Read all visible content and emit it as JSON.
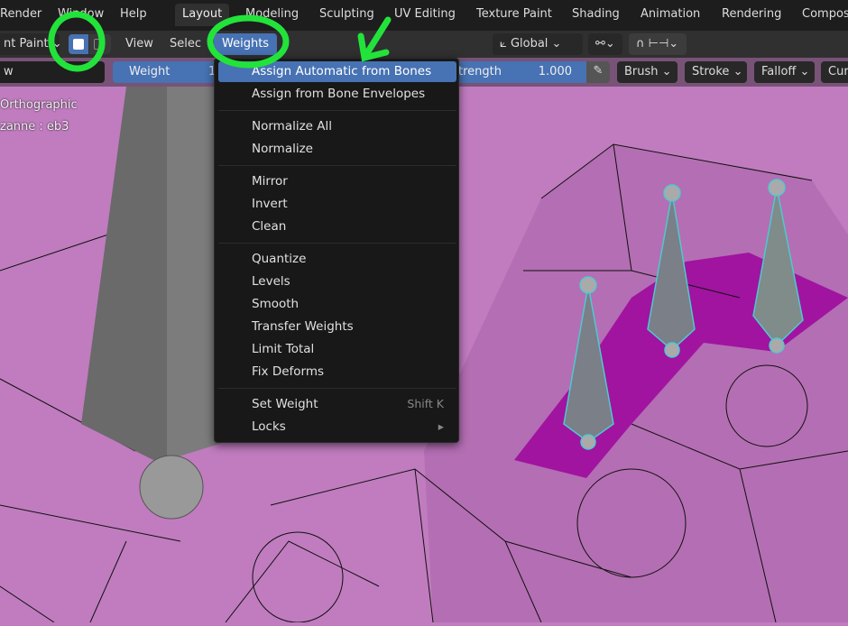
{
  "topbar": {
    "menus": [
      "Render",
      "Window",
      "Help"
    ],
    "workspaces": [
      "Layout",
      "Modeling",
      "Sculpting",
      "UV Editing",
      "Texture Paint",
      "Shading",
      "Animation",
      "Rendering",
      "Compos"
    ],
    "active_workspace": "Layout"
  },
  "header": {
    "mode": "nt Paint",
    "view": "View",
    "select": "Selec",
    "weights": "Weights",
    "orientation": "Global"
  },
  "toolsettings": {
    "field_left": "w",
    "weight_label": "Weight",
    "weight_value": "1",
    "strength_label": "trength",
    "strength_value": "1.000",
    "brush": "Brush",
    "stroke": "Stroke",
    "falloff": "Falloff",
    "cursor": "Cur"
  },
  "overlay": {
    "view_name": "Orthographic",
    "object": "zanne : eb3"
  },
  "menu": {
    "items": [
      {
        "label": "Assign Automatic from Bones",
        "highlighted": true
      },
      {
        "label": "Assign from Bone Envelopes"
      },
      {
        "label": "Normalize All"
      },
      {
        "label": "Normalize"
      },
      {
        "label": "Mirror"
      },
      {
        "label": "Invert"
      },
      {
        "label": "Clean"
      },
      {
        "label": "Quantize"
      },
      {
        "label": "Levels"
      },
      {
        "label": "Smooth"
      },
      {
        "label": "Transfer Weights"
      },
      {
        "label": "Limit Total"
      },
      {
        "label": "Fix Deforms"
      },
      {
        "label": "Set Weight",
        "shortcut": "Shift K"
      },
      {
        "label": "Locks",
        "submenu": "▸"
      }
    ]
  },
  "colors": {
    "accent": "#4772b3",
    "annotation": "#22e33a",
    "mesh": "#c07cbf",
    "weight_patch": "#a014a0"
  }
}
